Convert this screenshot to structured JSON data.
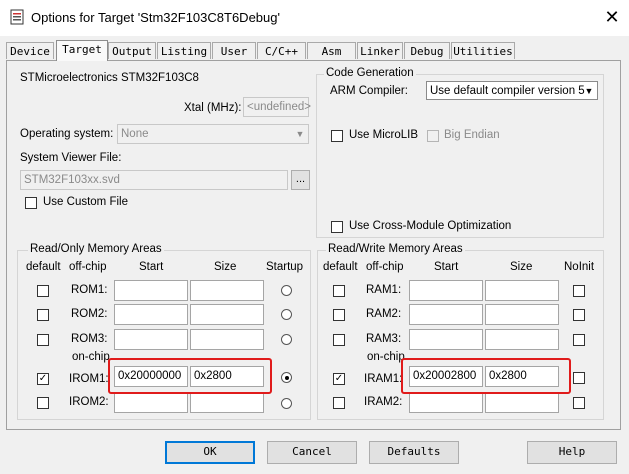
{
  "window": {
    "title": "Options for Target 'Stm32F103C8T6Debug'",
    "close_glyph": "✕"
  },
  "tabs": [
    "Device",
    "Target",
    "Output",
    "Listing",
    "User",
    "C/C++",
    "Asm",
    "Linker",
    "Debug",
    "Utilities"
  ],
  "active_tab": "Target",
  "device": {
    "name": "STMicroelectronics STM32F103C8",
    "xtal_label": "Xtal (MHz):",
    "xtal_value": "<undefined>",
    "os_label": "Operating system:",
    "os_value": "None",
    "svd_label": "System Viewer File:",
    "svd_value": "STM32F103xx.svd",
    "browse_label": "...",
    "custom_file_label": "Use Custom File"
  },
  "codegen": {
    "title": "Code Generation",
    "compiler_label": "ARM Compiler:",
    "compiler_value": "Use default compiler version 5",
    "microlib_label": "Use MicroLIB",
    "big_endian_label": "Big Endian",
    "cross_module_label": "Use Cross-Module Optimization"
  },
  "rom": {
    "title": "Read/Only Memory Areas",
    "headers": {
      "default": "default",
      "offchip": "off-chip",
      "start": "Start",
      "size": "Size",
      "startup": "Startup"
    },
    "onchip_label": "on-chip",
    "rows": [
      {
        "name": "ROM1:",
        "start": "",
        "size": "",
        "default": false,
        "startup": false
      },
      {
        "name": "ROM2:",
        "start": "",
        "size": "",
        "default": false,
        "startup": false
      },
      {
        "name": "ROM3:",
        "start": "",
        "size": "",
        "default": false,
        "startup": false
      },
      {
        "name": "IROM1:",
        "start": "0x20000000",
        "size": "0x2800",
        "default": true,
        "startup": true
      },
      {
        "name": "IROM2:",
        "start": "",
        "size": "",
        "default": false,
        "startup": false
      }
    ]
  },
  "ram": {
    "title": "Read/Write Memory Areas",
    "headers": {
      "default": "default",
      "offchip": "off-chip",
      "start": "Start",
      "size": "Size",
      "noinit": "NoInit"
    },
    "onchip_label": "on-chip",
    "rows": [
      {
        "name": "RAM1:",
        "start": "",
        "size": "",
        "default": false,
        "noinit": false
      },
      {
        "name": "RAM2:",
        "start": "",
        "size": "",
        "default": false,
        "noinit": false
      },
      {
        "name": "RAM3:",
        "start": "",
        "size": "",
        "default": false,
        "noinit": false
      },
      {
        "name": "IRAM1:",
        "start": "0x20002800",
        "size": "0x2800",
        "default": true,
        "noinit": false
      },
      {
        "name": "IRAM2:",
        "start": "",
        "size": "",
        "default": false,
        "noinit": false
      }
    ]
  },
  "buttons": {
    "ok": "OK",
    "cancel": "Cancel",
    "defaults": "Defaults",
    "help": "Help"
  },
  "colors": {
    "highlight": "#e01b1b",
    "focus": "#0078d7"
  }
}
